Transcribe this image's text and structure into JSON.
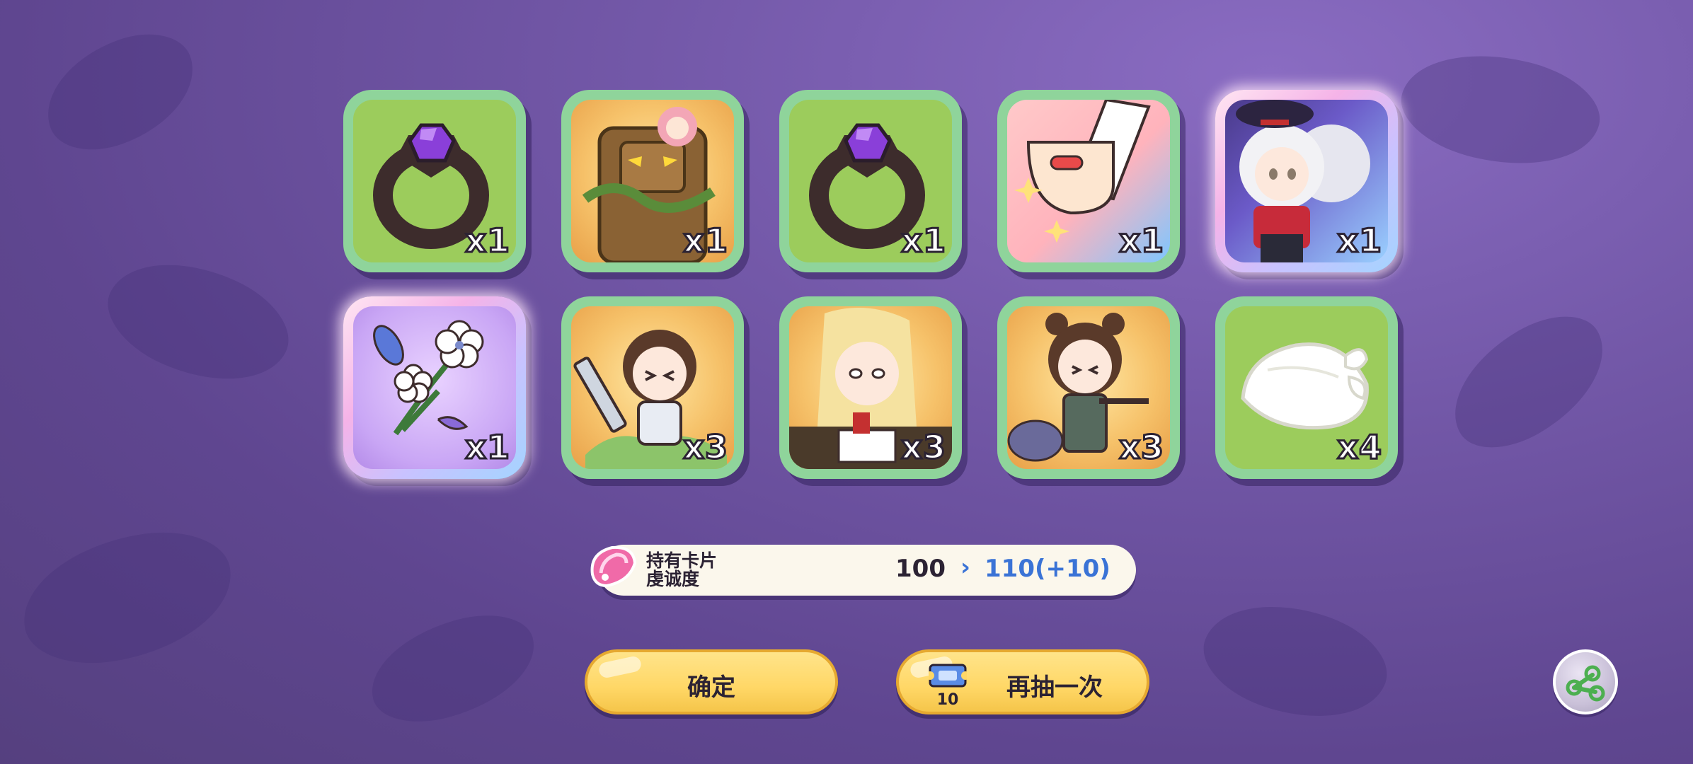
{
  "items": [
    {
      "name": "ring-purple-gem",
      "qty": "x1",
      "frame": "green",
      "bg": "green"
    },
    {
      "name": "tree-golem",
      "qty": "x1",
      "frame": "green",
      "bg": "orange"
    },
    {
      "name": "ring-purple-gem",
      "qty": "x1",
      "frame": "green",
      "bg": "green"
    },
    {
      "name": "pill-hand",
      "qty": "x1",
      "frame": "green",
      "bg": "pink"
    },
    {
      "name": "white-haired-character",
      "qty": "x1",
      "frame": "rainbow",
      "bg": "chara"
    },
    {
      "name": "flower-bouquet",
      "qty": "x1",
      "frame": "rainbow",
      "bg": "purple"
    },
    {
      "name": "sword-girl",
      "qty": "x3",
      "frame": "green",
      "bg": "orange"
    },
    {
      "name": "blonde-writer-girl",
      "qty": "x3",
      "frame": "green",
      "bg": "orange"
    },
    {
      "name": "bear-ear-girl",
      "qty": "x3",
      "frame": "green",
      "bg": "orange"
    },
    {
      "name": "white-bundle",
      "qty": "x4",
      "frame": "green",
      "bg": "green"
    }
  ],
  "affinity": {
    "label_line1": "持有卡片",
    "label_line2": "虔诚度",
    "current": "100",
    "arrow": "›",
    "next": "110(+10)"
  },
  "buttons": {
    "confirm_label": "确定",
    "again_label": "再抽一次",
    "ticket_count": "10"
  },
  "colors": {
    "frame_green": "#8fd49b",
    "button_yellow": "#ffd766",
    "accent_blue": "#3a73d6"
  }
}
